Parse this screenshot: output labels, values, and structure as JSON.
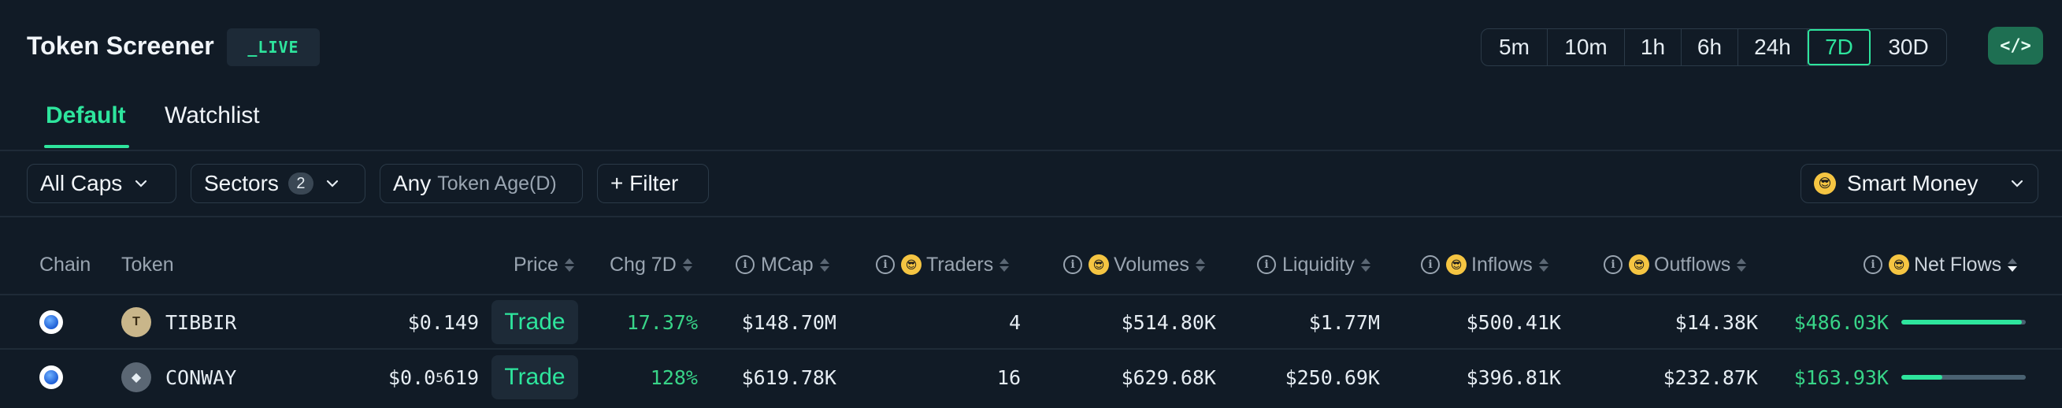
{
  "header": {
    "title": "Token Screener",
    "live_badge": "_LIVE",
    "time_ranges": [
      "5m",
      "10m",
      "1h",
      "6h",
      "24h",
      "7D",
      "30D"
    ],
    "active_time_range": "7D",
    "embed_icon": "code-icon",
    "embed_label": "</>"
  },
  "tabs": [
    {
      "label": "Default",
      "active": true
    },
    {
      "label": "Watchlist",
      "active": false
    }
  ],
  "filters": {
    "caps": "All Caps",
    "sectors_label": "Sectors",
    "sectors_count": "2",
    "token_age_value": "Any",
    "token_age_label": "Token Age(D)",
    "filter_label": "+ Filter",
    "smart_money_label": "Smart Money"
  },
  "columns": {
    "chain": "Chain",
    "token": "Token",
    "price": "Price",
    "change": "Chg 7D",
    "mcap": "MCap",
    "traders": "Traders",
    "volumes": "Volumes",
    "liquidity": "Liquidity",
    "inflows": "Inflows",
    "outflows": "Outflows",
    "net_flows": "Net Flows"
  },
  "rows": [
    {
      "token": "TIBBIR",
      "price": "$0.149",
      "trade_label": "Trade",
      "change": "17.37%",
      "mcap": "$148.70M",
      "traders": "4",
      "volumes": "$514.80K",
      "liquidity": "$1.77M",
      "inflows": "$500.41K",
      "outflows": "$14.38K",
      "net_flows": "$486.03K",
      "net_flow_ratio": 0.97
    },
    {
      "token": "CONWAY",
      "price_prefix": "$0.0",
      "price_sub": "5",
      "price_suffix": "619",
      "trade_label": "Trade",
      "change": "128%",
      "mcap": "$619.78K",
      "traders": "16",
      "volumes": "$629.68K",
      "liquidity": "$250.69K",
      "inflows": "$396.81K",
      "outflows": "$232.87K",
      "net_flows": "$163.93K",
      "net_flow_ratio": 0.33
    }
  ],
  "colors": {
    "accent": "#2ee59d",
    "background": "#111b26",
    "positive": "#38d488"
  }
}
